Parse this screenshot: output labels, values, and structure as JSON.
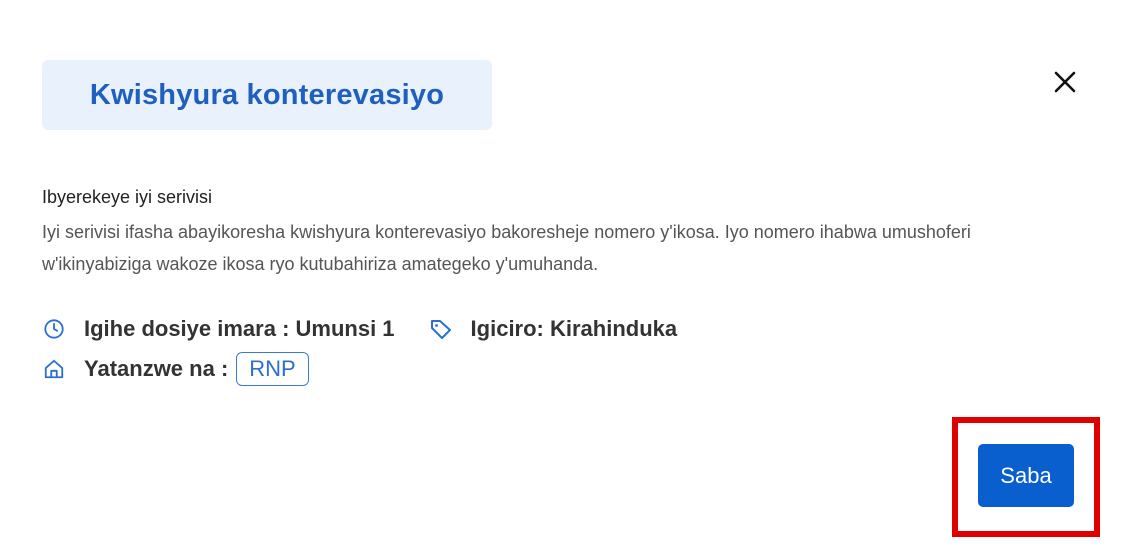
{
  "modal": {
    "title": "Kwishyura konterevasiyo",
    "close_icon": "close-icon"
  },
  "about": {
    "heading": "Ibyerekeye iyi serivisi",
    "description": "Iyi serivisi ifasha abayikoresha kwishyura konterevasiyo bakoresheje nomero y'ikosa. Iyo nomero ihabwa umushoferi w'ikinyabiziga wakoze ikosa ryo kutubahiriza amategeko y'umuhanda."
  },
  "meta": {
    "duration": {
      "icon": "clock-icon",
      "text": "Igihe dosiye imara : Umunsi 1"
    },
    "price": {
      "icon": "tag-icon",
      "text": "Igiciro: Kirahinduka"
    },
    "provider": {
      "icon": "home-icon",
      "label": "Yatanzwe na :",
      "badge": "RNP"
    }
  },
  "actions": {
    "next_label": "Saba"
  },
  "colors": {
    "accent": "#0a5fcf",
    "title_text": "#1f5fbf",
    "title_bg": "#e8f1fc",
    "highlight": "#e00000"
  }
}
